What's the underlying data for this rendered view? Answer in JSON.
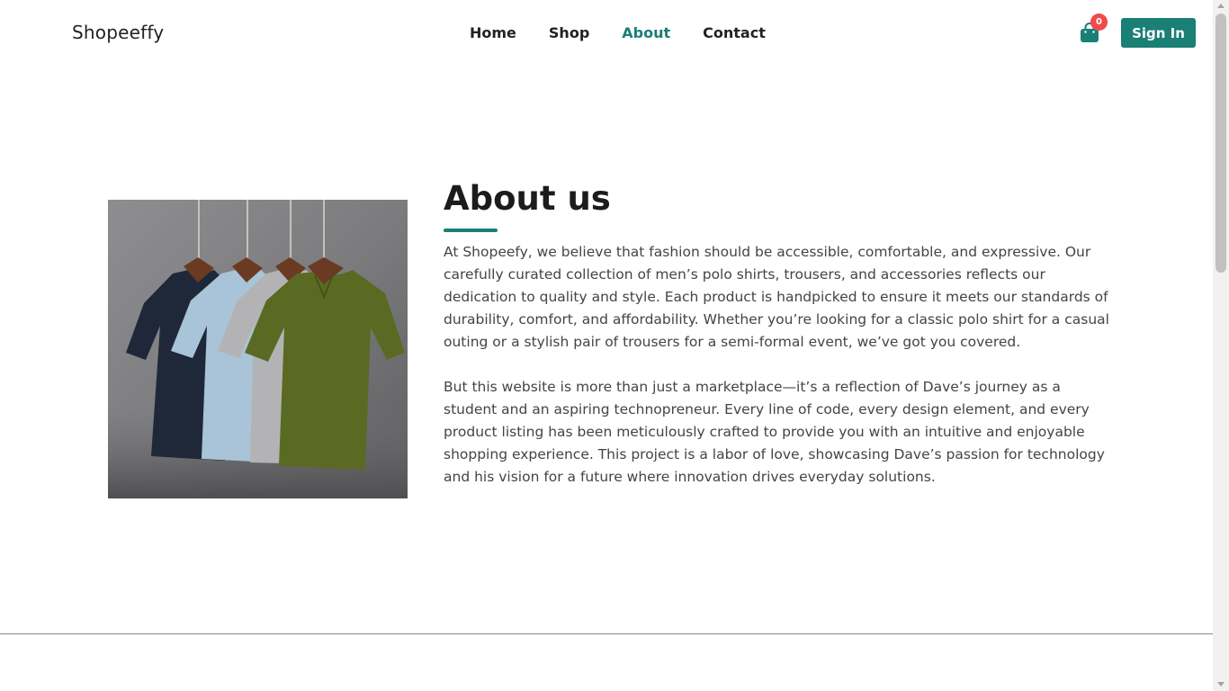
{
  "header": {
    "brand": "Shopeeffy",
    "nav": [
      {
        "label": "Home",
        "active": false
      },
      {
        "label": "Shop",
        "active": false
      },
      {
        "label": "About",
        "active": true
      },
      {
        "label": "Contact",
        "active": false
      }
    ],
    "cart": {
      "icon": "shopping-bag-icon",
      "count": "0"
    },
    "signin_label": "Sign In"
  },
  "about": {
    "title": "About us",
    "image_icon": "polo-shirts-photo",
    "paragraphs": [
      "At Shopeefy, we believe that fashion should be accessible, comfortable, and expressive. Our carefully curated collection of men’s polo shirts, trousers, and accessories reflects our dedication to quality and style. Each product is handpicked to ensure it meets our standards of durability, comfort, and affordability. Whether you’re looking for a classic polo shirt for a casual outing or a stylish pair of trousers for a semi-formal event, we’ve got you covered.",
      "But this website is more than just a marketplace—it’s a reflection of Dave’s journey as a student and an aspiring technopreneur. Every line of code, every design element, and every product listing has been meticulously crafted to provide you with an intuitive and enjoyable shopping experience. This project is a labor of love, showcasing Dave’s passion for technology and his vision for a future where innovation drives everyday solutions."
    ]
  },
  "colors": {
    "accent": "#1a7f74",
    "badge": "#f04a4a",
    "text": "#444444"
  }
}
